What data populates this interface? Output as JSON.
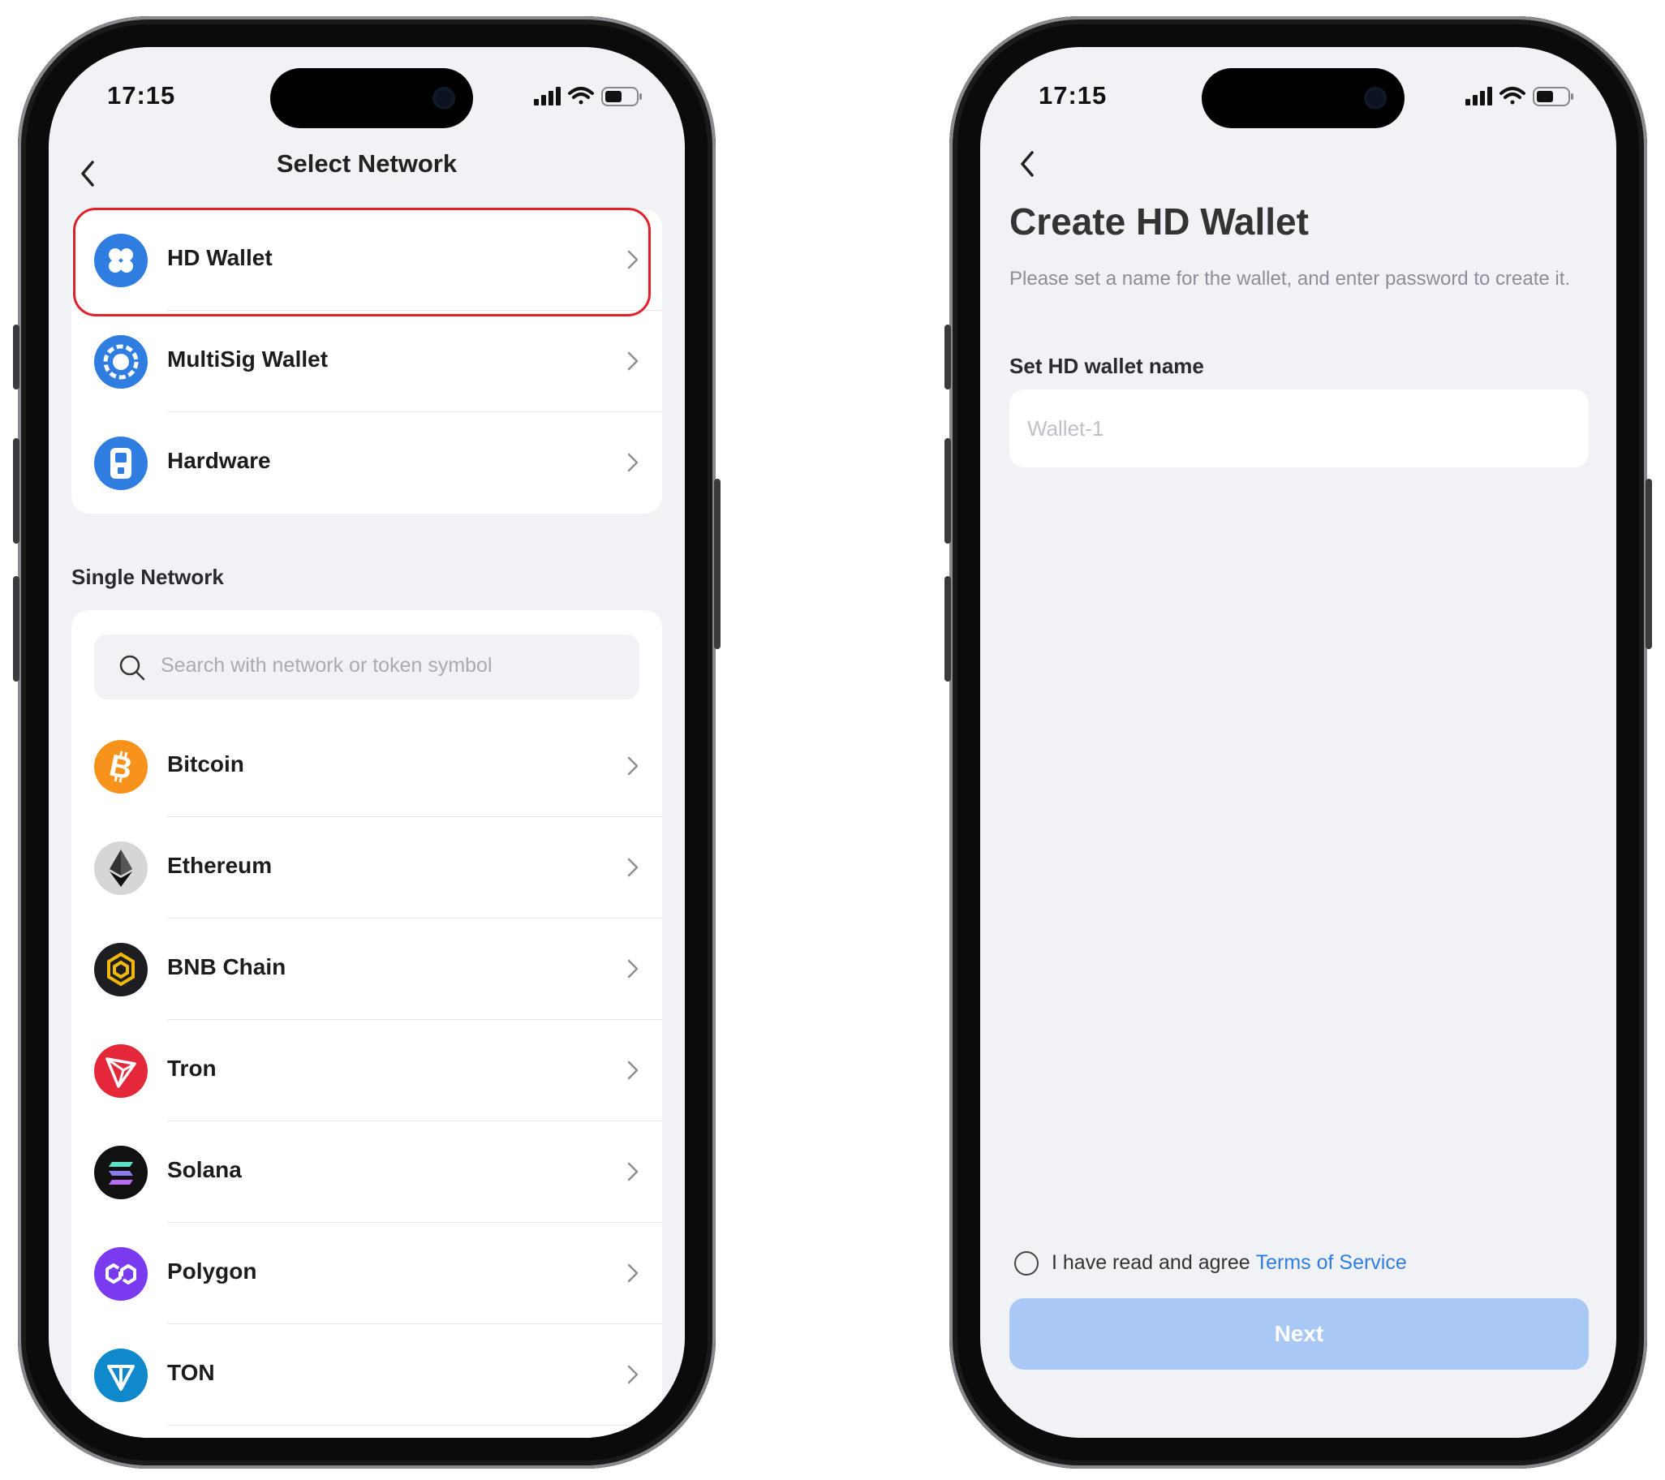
{
  "colors": {
    "background": "#f1f2f6",
    "accent": "#2f7de1",
    "highlight": "#e0202a",
    "button_disabled": "#a9c8f6"
  },
  "left_screen": {
    "status_time": "17:15",
    "nav_title": "Select Network",
    "wallet_types": [
      {
        "label": "HD Wallet",
        "icon": "hd-wallet-icon"
      },
      {
        "label": "MultiSig Wallet",
        "icon": "multisig-wallet-icon"
      },
      {
        "label": "Hardware",
        "icon": "hardware-icon"
      }
    ],
    "section_title": "Single Network",
    "search_placeholder": "Search with network or token symbol",
    "networks": [
      {
        "label": "Bitcoin",
        "icon": "bitcoin-icon",
        "color": "#f7931a"
      },
      {
        "label": "Ethereum",
        "icon": "ethereum-icon",
        "color": "#d6d6d9"
      },
      {
        "label": "BNB Chain",
        "icon": "bnb-chain-icon",
        "color": "#1e1e22"
      },
      {
        "label": "Tron",
        "icon": "tron-icon",
        "color": "#e4283a"
      },
      {
        "label": "Solana",
        "icon": "solana-icon",
        "color": "#111111"
      },
      {
        "label": "Polygon",
        "icon": "polygon-icon",
        "color": "#7a3bf0"
      },
      {
        "label": "TON",
        "icon": "ton-icon",
        "color": "#0f88cc"
      }
    ]
  },
  "right_screen": {
    "status_time": "17:15",
    "title": "Create HD Wallet",
    "subtitle": "Please set a name for the wallet, and enter password to create it.",
    "field_label": "Set HD wallet name",
    "field_placeholder": "Wallet-1",
    "field_value": "",
    "agree_text": "I have read and agree",
    "terms_link": "Terms of Service",
    "next_label": "Next"
  }
}
